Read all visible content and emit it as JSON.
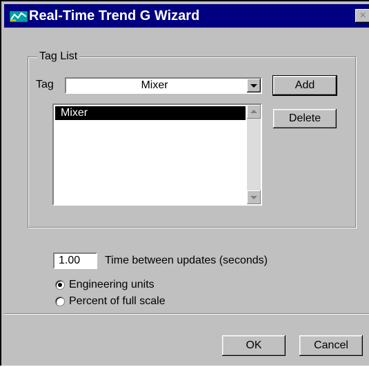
{
  "window": {
    "title": "Real-Time Trend G Wizard",
    "close_glyph": "×"
  },
  "tag_list": {
    "group_label": "Tag List",
    "tag_label": "Tag",
    "tag_value": "Mixer",
    "add_label": "Add",
    "delete_label": "Delete",
    "items": [
      {
        "label": "Mixer",
        "selected": true
      }
    ]
  },
  "settings": {
    "time_value": "1.00",
    "time_label": "Time between updates (seconds)",
    "options": [
      {
        "label": "Engineering units",
        "checked": true
      },
      {
        "label": "Percent of full scale",
        "checked": false
      }
    ]
  },
  "buttons": {
    "ok_label": "OK",
    "cancel_label": "Cancel"
  },
  "colors": {
    "title_bar": "#000080",
    "face": "#c0c0c0",
    "selection": "#000000"
  }
}
